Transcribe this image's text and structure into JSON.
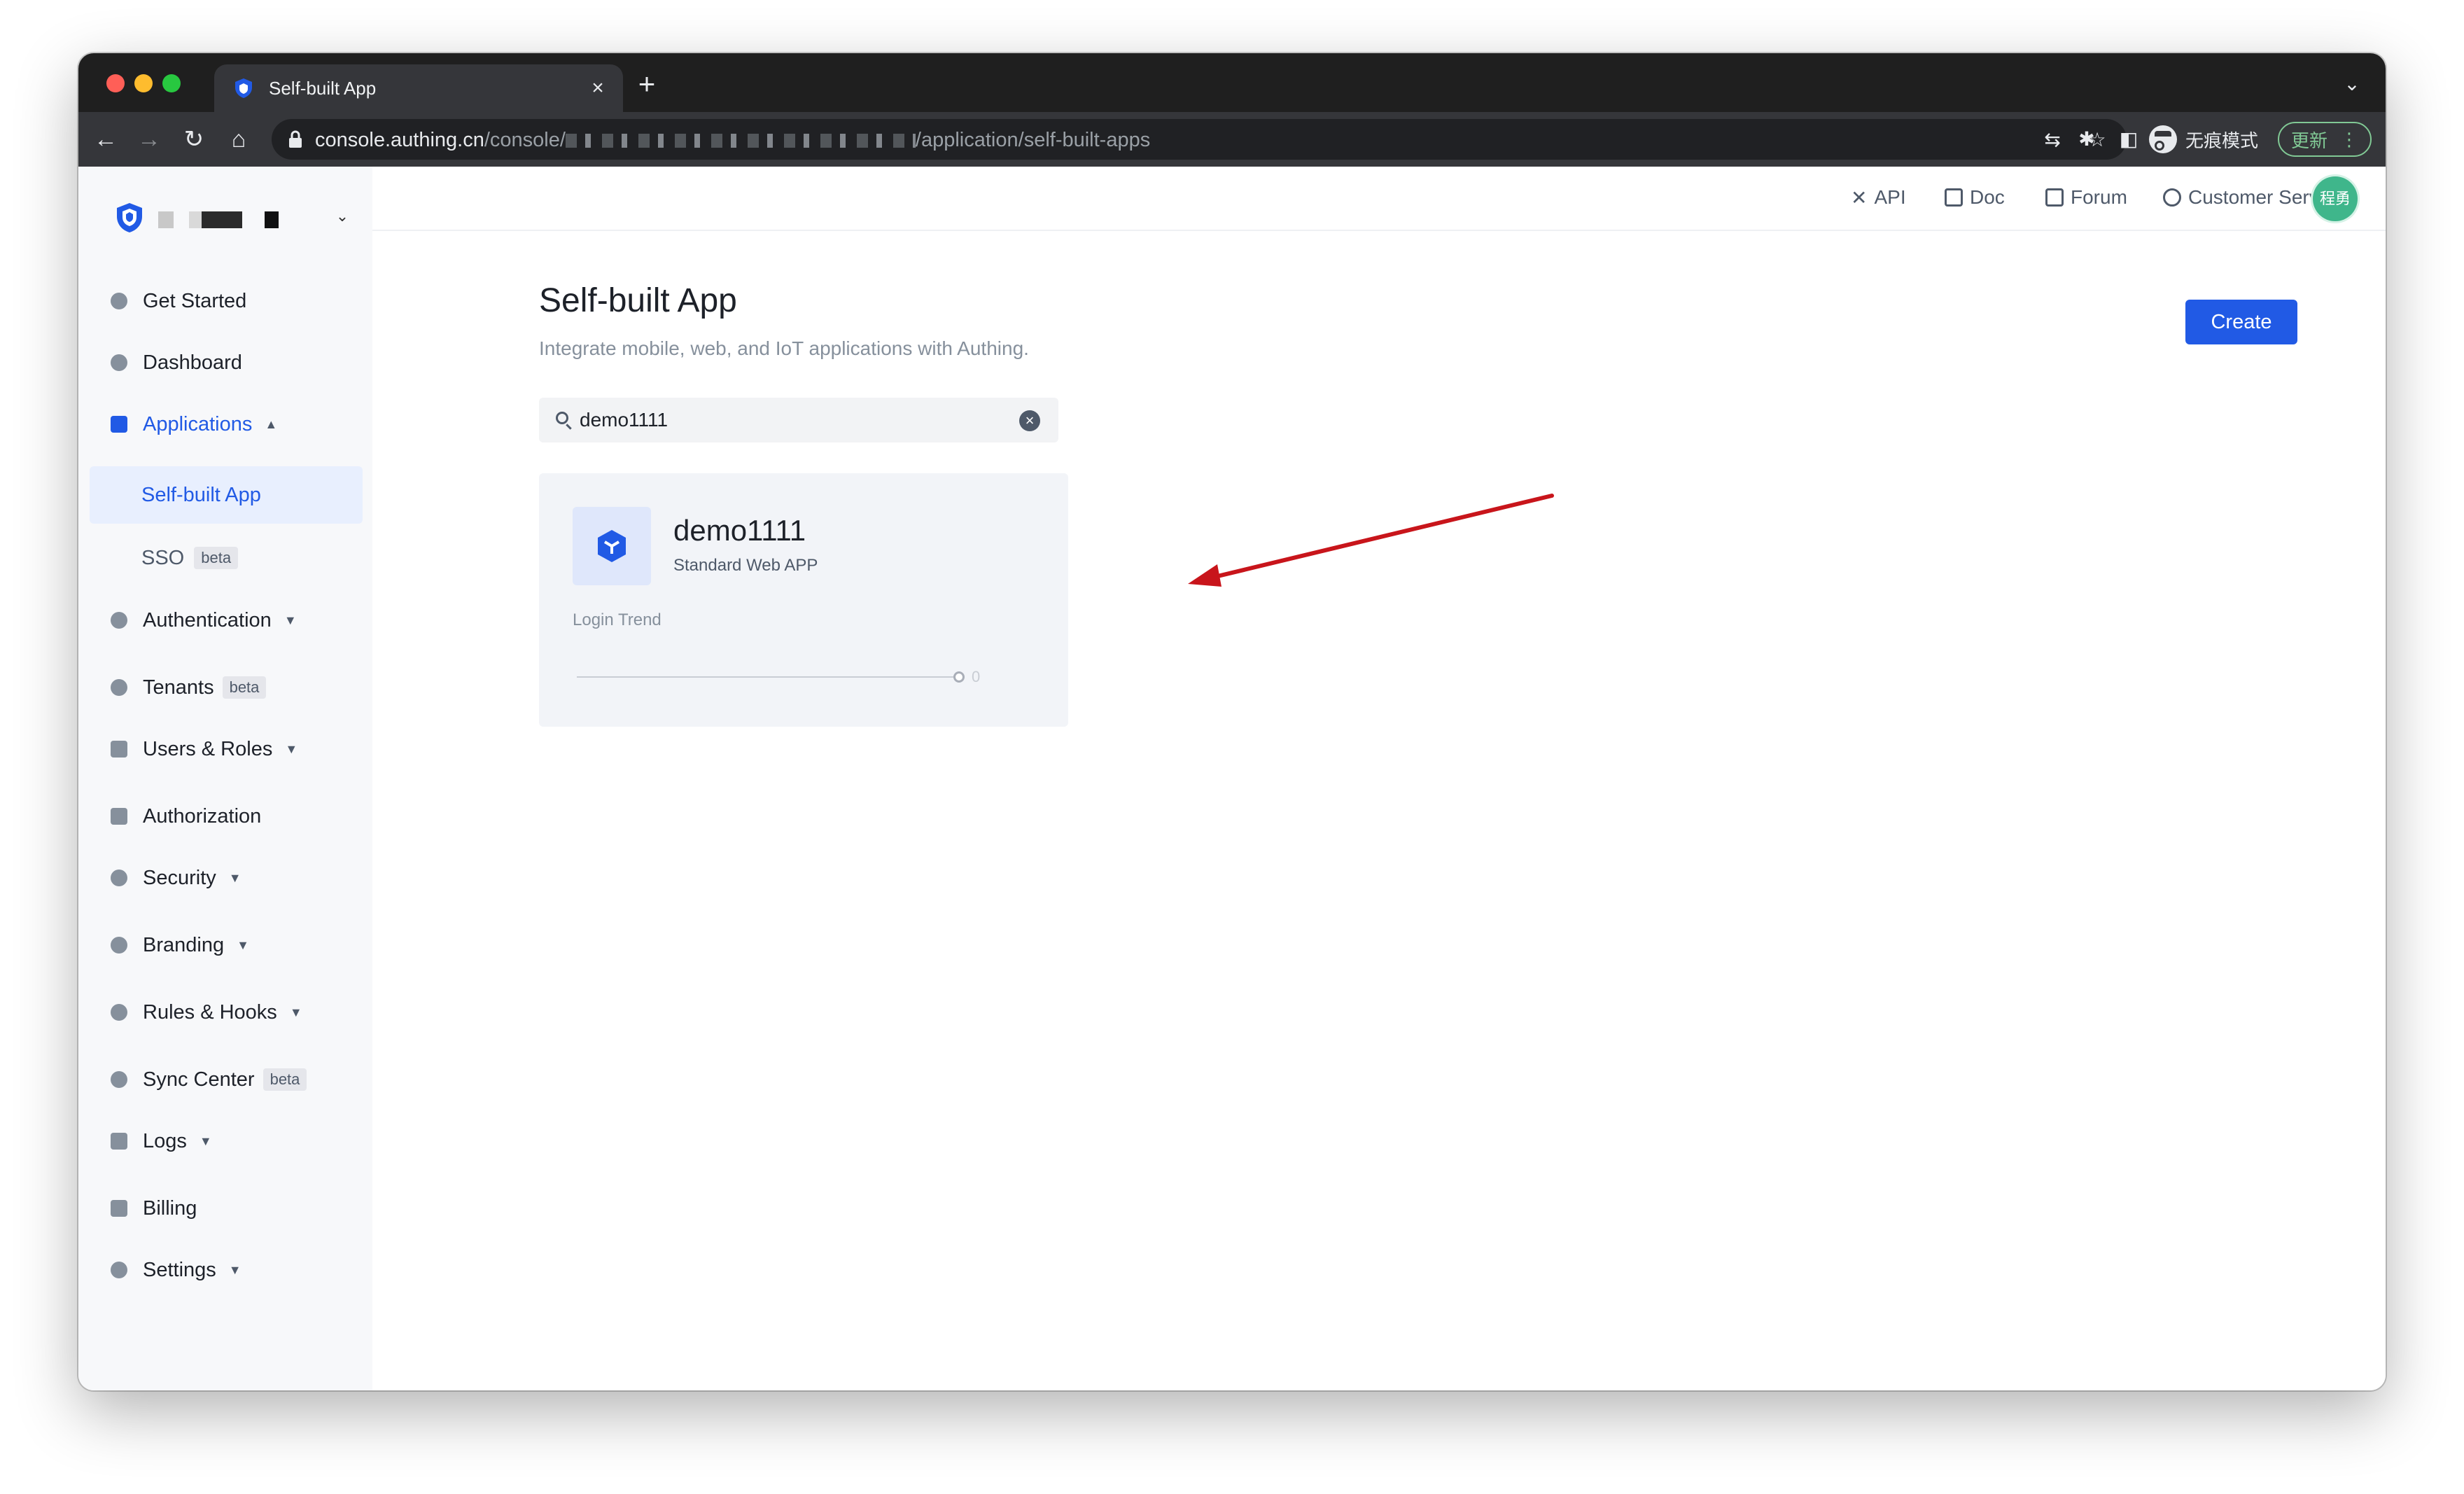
{
  "browser": {
    "tab_title": "Self-built App",
    "tab_close": "×",
    "new_tab": "+",
    "tab_menu": "⌄",
    "url_host": "console.authing.cn",
    "url_path_start": "/console/",
    "url_path_end": "/application/self-built-apps",
    "incognito_label": "无痕模式",
    "update_label": "更新",
    "nav_icons": [
      "back-arrow-icon",
      "forward-arrow-icon",
      "reload-icon",
      "home-icon"
    ],
    "right_icons": [
      "translate-icon",
      "bookmark-star-icon",
      "extensions-puzzle-icon",
      "side-panel-icon"
    ]
  },
  "sidebar": {
    "org_caret": "⌄",
    "items": [
      {
        "label": "Get Started",
        "icon": "rocket-icon"
      },
      {
        "label": "Dashboard",
        "icon": "pie-chart-icon"
      },
      {
        "label": "Applications",
        "icon": "apps-grid-icon",
        "caret": "▲"
      },
      {
        "label": "Authentication",
        "icon": "share-nodes-icon",
        "caret": "▼"
      },
      {
        "label": "Tenants",
        "icon": "globe-icon",
        "badge": "beta"
      },
      {
        "label": "Users & Roles",
        "icon": "users-icon",
        "caret": "▼"
      },
      {
        "label": "Authorization",
        "icon": "lock-icon"
      },
      {
        "label": "Security",
        "icon": "shield-icon",
        "caret": "▼"
      },
      {
        "label": "Branding",
        "icon": "paint-brush-icon",
        "caret": "▼"
      },
      {
        "label": "Rules & Hooks",
        "icon": "hook-icon",
        "caret": "▼"
      },
      {
        "label": "Sync Center",
        "icon": "sync-icon",
        "badge": "beta"
      },
      {
        "label": "Logs",
        "icon": "log-list-icon",
        "caret": "▼"
      },
      {
        "label": "Billing",
        "icon": "credit-card-icon"
      },
      {
        "label": "Settings",
        "icon": "gear-icon",
        "caret": "▼"
      }
    ],
    "sub_items": [
      {
        "label": "Self-built App"
      },
      {
        "label": "SSO",
        "badge": "beta"
      }
    ]
  },
  "topnav": {
    "links": [
      {
        "label": "API",
        "icon": "tools-icon"
      },
      {
        "label": "Doc",
        "icon": "book-icon"
      },
      {
        "label": "Forum",
        "icon": "message-square-icon"
      },
      {
        "label": "Customer Service",
        "icon": "headset-icon"
      }
    ],
    "avatar_text": "程勇"
  },
  "main": {
    "title": "Self-built App",
    "description": "Integrate mobile, web, and IoT applications with Authing.",
    "create_label": "Create",
    "search_value": "demo1111",
    "clear_glyph": "×"
  },
  "app_card": {
    "name": "demo1111",
    "type": "Standard Web APP",
    "trend_label": "Login Trend",
    "trend_value": "0",
    "icon": "cube-icon"
  },
  "colors": {
    "accent": "#215ae5",
    "annotation_arrow": "#c8151b",
    "avatar": "#3fb68b"
  }
}
